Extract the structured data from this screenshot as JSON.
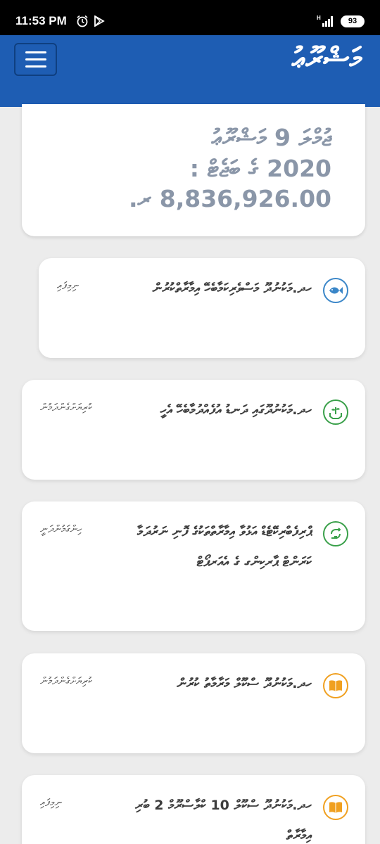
{
  "status_bar": {
    "time": "11:53 PM",
    "network": "H",
    "battery": "93"
  },
  "app_bar": {
    "title": "މަޝްރޫޢު"
  },
  "summary": {
    "line1": "ޖުމްލަ 9 މަޝްރޫޢު",
    "line2": "2020 ގެ ބަޖެޓް :",
    "line3": "8,836,926.00 ރ."
  },
  "projects": [
    {
      "title": "ހދ.މަކުނުދޫ މަސްވެރިކަމާބެހޭ އިމާރާތްކުރުން",
      "status": "ނިމިފައި",
      "icon": "fish-icon",
      "icon_color": "#3a86c8"
    },
    {
      "title": "ހދ.މަކުނުދޫގައި ދަނޑު އުފެއްދުމާބެހޭ އެހީ",
      "status": "ކުރިޔަށްގެންދަމުން",
      "icon": "plant-hands-icon",
      "icon_color": "#3aa04a"
    },
    {
      "title": "ޕްރިފެބްރިކޭޓެޑް އަޅުވާ އިމާރާތްތަކުގެ ފޮނި ނަރުދަމާ ކަރަންޓް ޕާރކިންގ ގެ އެއަރޕޯޓް",
      "status": "ހިންގަމުންދަނީ",
      "icon": "recycle-plug-icon",
      "icon_color": "#3aa04a"
    },
    {
      "title": "ހދ.މަކުނުދޫ ސްކޫލް މަރާމާތު ކުރުން",
      "status": "ކުރިޔަށްގެންދަމުން",
      "icon": "book-icon",
      "icon_color": "#f0a020"
    },
    {
      "title": "ހދ.މަކުނުދޫ ސްކޫލް 10 ކްލާސްރޫމް 2 ބުރި އިމާރާތް",
      "status": "ނިމިފައި",
      "icon": "book-icon",
      "icon_color": "#f0a020"
    }
  ]
}
